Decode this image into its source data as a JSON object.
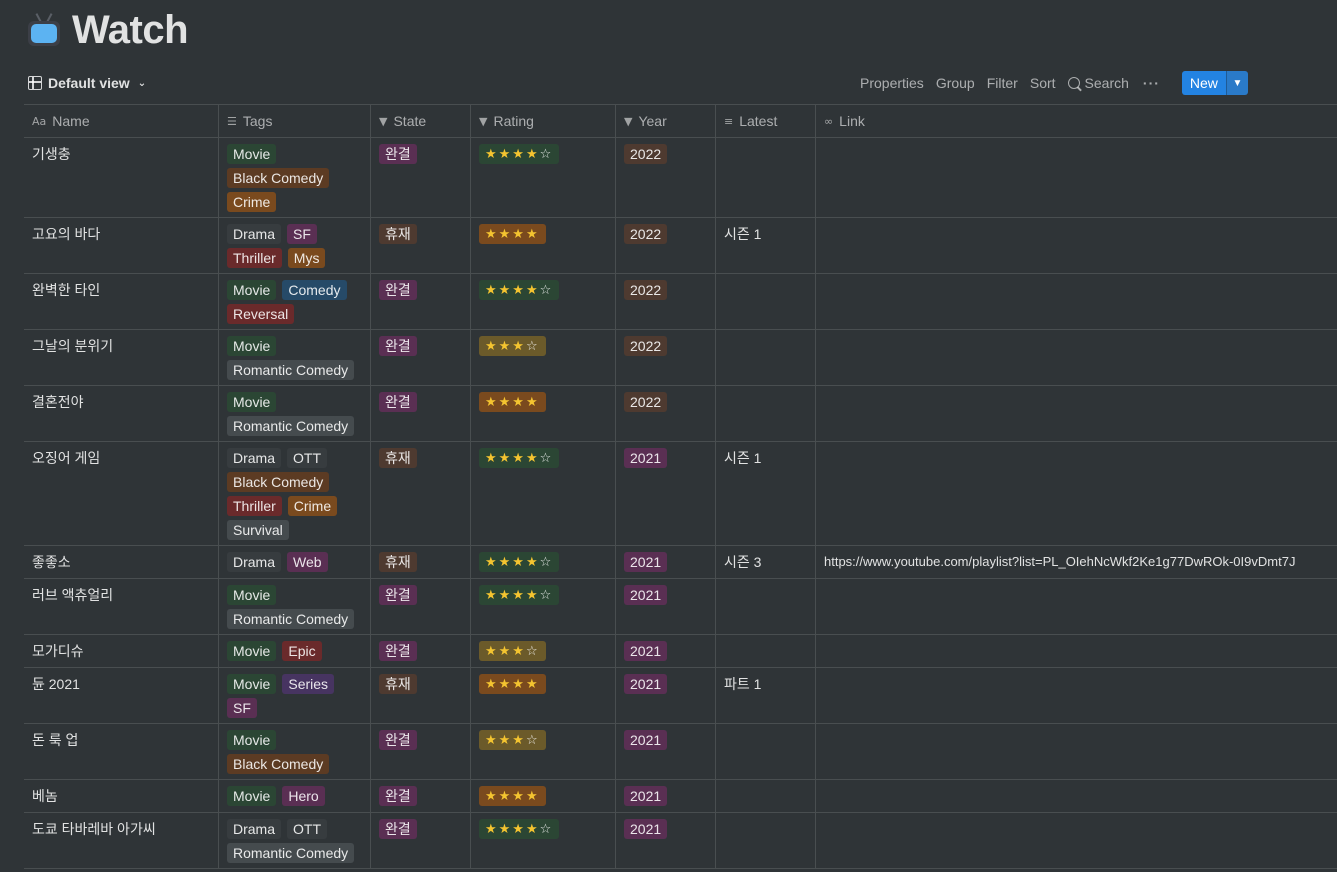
{
  "page": {
    "title": "Watch",
    "icon": "tv-icon"
  },
  "toolbar": {
    "view_label": "Default view",
    "properties": "Properties",
    "group": "Group",
    "filter": "Filter",
    "sort": "Sort",
    "search": "Search",
    "more": "···",
    "new": "New"
  },
  "columns": [
    {
      "key": "name",
      "label": "Name",
      "icon": "Aa"
    },
    {
      "key": "tags",
      "label": "Tags",
      "icon": "☰"
    },
    {
      "key": "state",
      "label": "State",
      "icon": "▼"
    },
    {
      "key": "rating",
      "label": "Rating",
      "icon": "▼"
    },
    {
      "key": "year",
      "label": "Year",
      "icon": "▼"
    },
    {
      "key": "latest",
      "label": "Latest",
      "icon": "≡"
    },
    {
      "key": "link",
      "label": "Link",
      "icon": "∞"
    }
  ],
  "colors": {
    "Movie": "#2b4634",
    "Drama": "#373c3f",
    "Black Comedy": "#5c3b23",
    "Crime": "#7a4a1e",
    "SF": "#5a2f53",
    "Thriller": "#6a2a2b",
    "Mys": "#7a4a1e",
    "Comedy": "#264a68",
    "Reversal": "#6a2a2b",
    "Romantic Comedy": "#454b4e",
    "OTT": "#373c3f",
    "Survival": "#454b4e",
    "Web": "#5a2f53",
    "Epic": "#6a2a2b",
    "Series": "#473461",
    "Hero": "#5a2f53",
    "완결": "#5a2f53",
    "휴재": "#4e3a30",
    "2022": "#4e3a30",
    "2021": "#5a2f53",
    "rating_green": "#2b4634",
    "rating_brown": "#7a4a1e",
    "rating_gold": "#6b5a2a"
  },
  "rows": [
    {
      "name": "기생충",
      "tags": [
        "Movie",
        "Black Comedy",
        "Crime"
      ],
      "state": "완결",
      "rating": {
        "filled": 4,
        "empty": 1,
        "color": "rating_green"
      },
      "year": "2022",
      "latest": "",
      "link": "",
      "height": 80
    },
    {
      "name": "고요의 바다",
      "tags": [
        "Drama",
        "SF",
        "Thriller",
        "Mys"
      ],
      "state": "휴재",
      "rating": {
        "filled": 4,
        "empty": 0,
        "color": "rating_brown"
      },
      "year": "2022",
      "latest": "시즌 1",
      "link": "",
      "height": 56
    },
    {
      "name": "완벽한 타인",
      "tags": [
        "Movie",
        "Comedy",
        "Reversal"
      ],
      "state": "완결",
      "rating": {
        "filled": 4,
        "empty": 1,
        "color": "rating_green"
      },
      "year": "2022",
      "latest": "",
      "link": "",
      "height": 56
    },
    {
      "name": "그날의 분위기",
      "tags": [
        "Movie",
        "Romantic Comedy"
      ],
      "state": "완결",
      "rating": {
        "filled": 3,
        "empty": 1,
        "color": "rating_gold"
      },
      "year": "2022",
      "latest": "",
      "link": "",
      "height": 56
    },
    {
      "name": "결혼전야",
      "tags": [
        "Movie",
        "Romantic Comedy"
      ],
      "state": "완결",
      "rating": {
        "filled": 4,
        "empty": 0,
        "color": "rating_brown"
      },
      "year": "2022",
      "latest": "",
      "link": "",
      "height": 56
    },
    {
      "name": "오징어 게임",
      "tags": [
        "Drama",
        "OTT",
        "Black Comedy",
        "Thriller",
        "Crime",
        "Survival"
      ],
      "state": "휴재",
      "rating": {
        "filled": 4,
        "empty": 1,
        "color": "rating_green"
      },
      "year": "2021",
      "latest": "시즌 1",
      "link": "",
      "height": 104
    },
    {
      "name": "좋좋소",
      "tags": [
        "Drama",
        "Web"
      ],
      "state": "휴재",
      "rating": {
        "filled": 4,
        "empty": 1,
        "color": "rating_green"
      },
      "year": "2021",
      "latest": "시즌 3",
      "link": "https://www.youtube.com/playlist?list=PL_OIehNcWkf2Ke1g77DwROk-0I9vDmt7J",
      "height": 33
    },
    {
      "name": "러브 액츄얼리",
      "tags": [
        "Movie",
        "Romantic Comedy"
      ],
      "state": "완결",
      "rating": {
        "filled": 4,
        "empty": 1,
        "color": "rating_green"
      },
      "year": "2021",
      "latest": "",
      "link": "",
      "height": 56
    },
    {
      "name": "모가디슈",
      "tags": [
        "Movie",
        "Epic"
      ],
      "state": "완결",
      "rating": {
        "filled": 3,
        "empty": 1,
        "color": "rating_gold"
      },
      "year": "2021",
      "latest": "",
      "link": "",
      "height": 33
    },
    {
      "name": "듄 2021",
      "tags": [
        "Movie",
        "Series",
        "SF"
      ],
      "state": "휴재",
      "rating": {
        "filled": 4,
        "empty": 0,
        "color": "rating_brown"
      },
      "year": "2021",
      "latest": "파트 1",
      "link": "",
      "height": 56
    },
    {
      "name": "돈 룩 업",
      "tags": [
        "Movie",
        "Black Comedy"
      ],
      "state": "완결",
      "rating": {
        "filled": 3,
        "empty": 1,
        "color": "rating_gold"
      },
      "year": "2021",
      "latest": "",
      "link": "",
      "height": 56
    },
    {
      "name": "베놈",
      "tags": [
        "Movie",
        "Hero"
      ],
      "state": "완결",
      "rating": {
        "filled": 4,
        "empty": 0,
        "color": "rating_brown"
      },
      "year": "2021",
      "latest": "",
      "link": "",
      "height": 33
    },
    {
      "name": "도쿄 타바레바 아가씨",
      "tags": [
        "Drama",
        "OTT",
        "Romantic Comedy"
      ],
      "state": "완결",
      "rating": {
        "filled": 4,
        "empty": 1,
        "color": "rating_green"
      },
      "year": "2021",
      "latest": "",
      "link": "",
      "height": 56
    }
  ]
}
